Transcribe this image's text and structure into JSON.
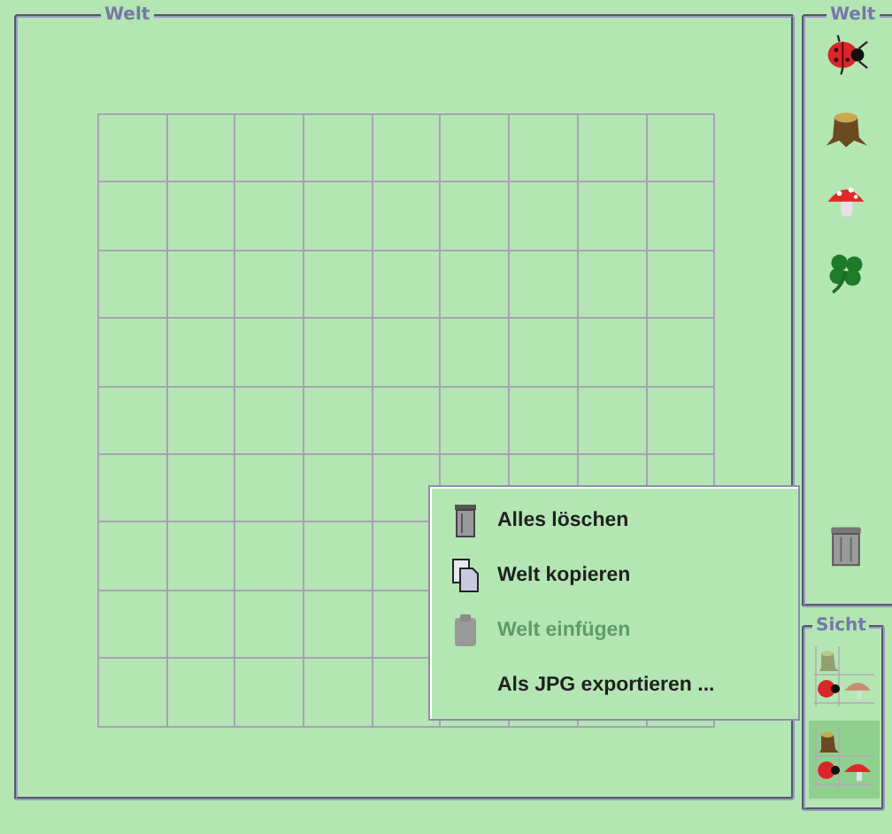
{
  "world_panel": {
    "title": "Welt"
  },
  "palette": {
    "title": "Welt",
    "items": [
      {
        "kind": "ladybug"
      },
      {
        "kind": "stump"
      },
      {
        "kind": "mushroom"
      },
      {
        "kind": "clover"
      }
    ],
    "trash": {
      "kind": "trash"
    }
  },
  "view": {
    "title": "Sicht",
    "options": [
      {
        "kind": "faded",
        "selected": false
      },
      {
        "kind": "full",
        "selected": true
      }
    ]
  },
  "context_menu": {
    "items": [
      {
        "kind": "trash",
        "label": "Alles löschen",
        "disabled": false
      },
      {
        "kind": "copy",
        "label": "Welt kopieren",
        "disabled": false
      },
      {
        "kind": "paste",
        "label": "Welt einfügen",
        "disabled": true
      },
      {
        "kind": "plain",
        "label": "Als JPG exportieren ...",
        "disabled": false
      }
    ]
  }
}
